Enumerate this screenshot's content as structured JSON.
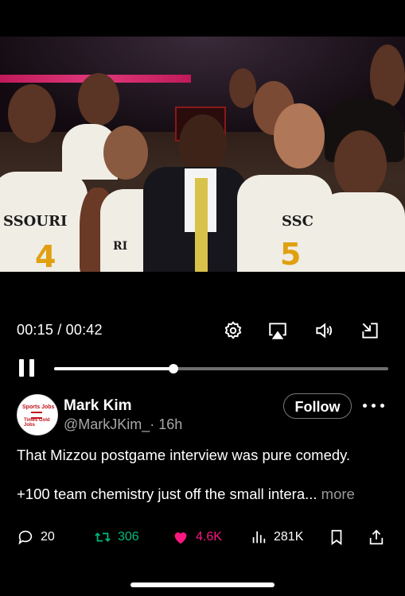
{
  "video": {
    "current_time": "00:15",
    "duration": "00:42",
    "time_display": "00:15 / 00:42",
    "progress": 0.357,
    "jersey_texts": {
      "left": "SSOURI",
      "center": "SSC",
      "small": "RI"
    },
    "jersey_numbers": {
      "left": "4",
      "right": "5"
    }
  },
  "controls": {
    "settings_icon": "gear-icon",
    "airplay_icon": "airplay-icon",
    "volume_icon": "speaker-icon",
    "minimize_icon": "minimize-icon",
    "pause_icon": "pause-icon"
  },
  "post": {
    "avatar_text_top": "Sports Jobs",
    "avatar_text_bottom": "Times Gold Jobs",
    "author_name": "Mark Kim",
    "author_handle": "@MarkJKim_",
    "timestamp": "· 16h",
    "follow_label": "Follow",
    "text_line1": "That Mizzou postgame interview was pure comedy.",
    "text_line2": "+100 team chemistry just off the small intera...",
    "more_label": " more"
  },
  "actions": {
    "replies": "20",
    "reposts": "306",
    "likes": "4.6K",
    "views": "281K",
    "repost_color": "#00ba7c",
    "like_color": "#f91880"
  }
}
